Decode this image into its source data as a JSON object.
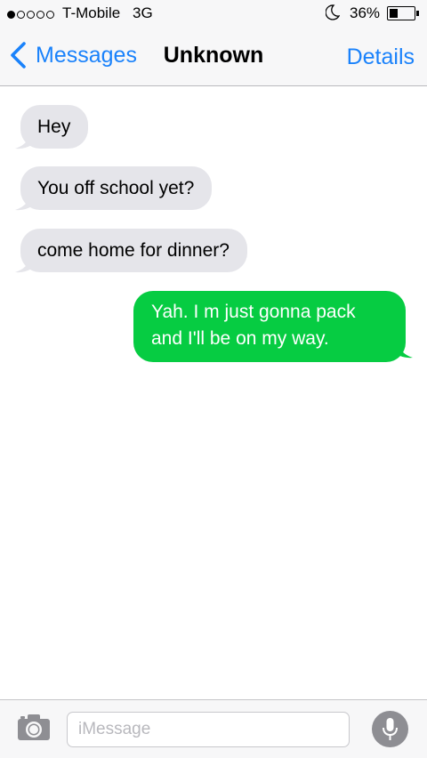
{
  "status_bar": {
    "signal_strength": 1,
    "signal_max": 5,
    "carrier": "T-Mobile",
    "network": "3G",
    "do_not_disturb_icon": "moon-icon",
    "battery_percent": "36%",
    "battery_level": 0.36
  },
  "nav": {
    "back_label": "Messages",
    "back_icon": "chevron-left-icon",
    "title": "Unknown",
    "details_label": "Details"
  },
  "messages": [
    {
      "direction": "incoming",
      "text": "Hey"
    },
    {
      "direction": "incoming",
      "text": "You off school yet?"
    },
    {
      "direction": "incoming",
      "text": "come home for dinner?"
    },
    {
      "direction": "outgoing",
      "text_lines": [
        "Yah. I m just gonna pack",
        "and I'll be on my way."
      ]
    }
  ],
  "composer": {
    "camera_icon": "camera-icon",
    "placeholder": "iMessage",
    "value": "",
    "mic_icon": "microphone-icon"
  },
  "colors": {
    "accent": "#1a82fb",
    "incoming_bubble": "#e5e5ea",
    "outgoing_bubble": "#06cc42",
    "bar_background": "#f7f7f8"
  }
}
